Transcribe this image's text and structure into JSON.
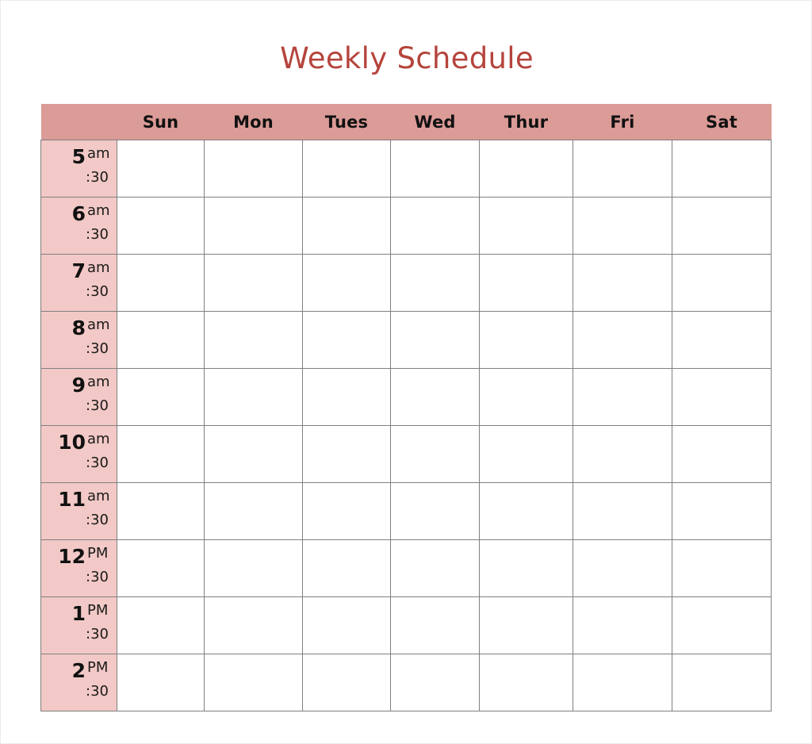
{
  "page": {
    "title": "Weekly Schedule",
    "title_color": "#b5443c",
    "header_bg": "#db9b97",
    "time_col_bg": "#f2c9c6",
    "grid_line_color": "#808080",
    "cell_bg": "#ffffff"
  },
  "header": {
    "time_label": "",
    "days": [
      {
        "label": "Sun"
      },
      {
        "label": "Mon"
      },
      {
        "label": "Tues"
      },
      {
        "label": "Wed"
      },
      {
        "label": "Thur"
      },
      {
        "label": "Fri"
      },
      {
        "label": "Sat"
      }
    ]
  },
  "rows": [
    {
      "hour": "5",
      "meridiem": "am",
      "half": ":30"
    },
    {
      "hour": "6",
      "meridiem": "am",
      "half": ":30"
    },
    {
      "hour": "7",
      "meridiem": "am",
      "half": ":30"
    },
    {
      "hour": "8",
      "meridiem": "am",
      "half": ":30"
    },
    {
      "hour": "9",
      "meridiem": "am",
      "half": ":30"
    },
    {
      "hour": "10",
      "meridiem": "am",
      "half": ":30"
    },
    {
      "hour": "11",
      "meridiem": "am",
      "half": ":30"
    },
    {
      "hour": "12",
      "meridiem": "PM",
      "half": ":30"
    },
    {
      "hour": "1",
      "meridiem": "PM",
      "half": ":30"
    },
    {
      "hour": "2",
      "meridiem": "PM",
      "half": ":30"
    }
  ],
  "cells": [
    [
      "",
      "",
      "",
      "",
      "",
      "",
      ""
    ],
    [
      "",
      "",
      "",
      "",
      "",
      "",
      ""
    ],
    [
      "",
      "",
      "",
      "",
      "",
      "",
      ""
    ],
    [
      "",
      "",
      "",
      "",
      "",
      "",
      ""
    ],
    [
      "",
      "",
      "",
      "",
      "",
      "",
      ""
    ],
    [
      "",
      "",
      "",
      "",
      "",
      "",
      ""
    ],
    [
      "",
      "",
      "",
      "",
      "",
      "",
      ""
    ],
    [
      "",
      "",
      "",
      "",
      "",
      "",
      ""
    ],
    [
      "",
      "",
      "",
      "",
      "",
      "",
      ""
    ],
    [
      "",
      "",
      "",
      "",
      "",
      "",
      ""
    ]
  ]
}
